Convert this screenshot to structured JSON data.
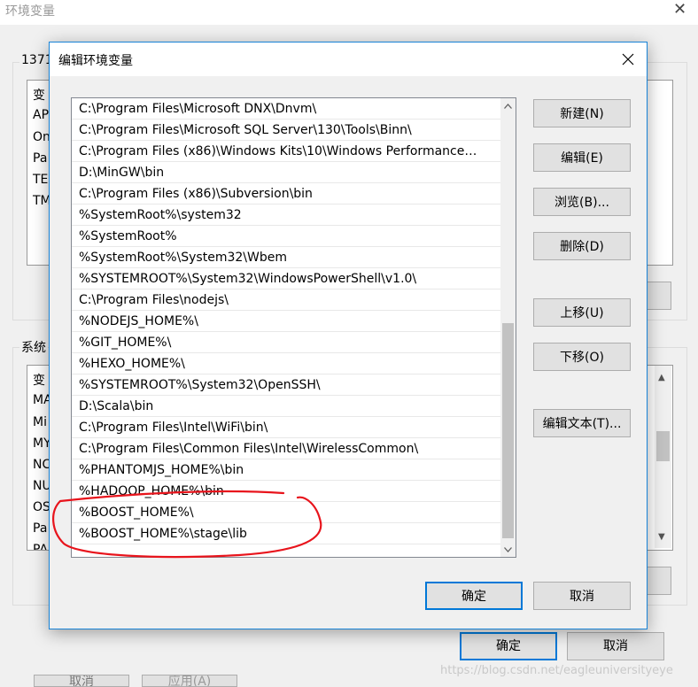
{
  "background": {
    "title": "环境变量",
    "user_group_label": "1371",
    "user_vars_col": "变",
    "user_vars": [
      "AP",
      "On",
      "Pa",
      "TE",
      "TM"
    ],
    "system_group_label": "系统",
    "system_vars_col": "变",
    "system_vars": [
      "MA",
      "Mi",
      "MY",
      "NC",
      "NU",
      "OS",
      "Pa",
      "PA"
    ],
    "ok_label": "确定",
    "cancel_label": "取消",
    "bottom_btn1": "取消",
    "bottom_btn2": "应用(A)",
    "watermark": "https://blog.csdn.net/eagleuniversityeye"
  },
  "dialog": {
    "title": "编辑环境变量",
    "paths": [
      "C:\\Program Files\\Microsoft DNX\\Dnvm\\",
      "C:\\Program Files\\Microsoft SQL Server\\130\\Tools\\Binn\\",
      "C:\\Program Files (x86)\\Windows Kits\\10\\Windows Performance…",
      "D:\\MinGW\\bin",
      "C:\\Program Files (x86)\\Subversion\\bin",
      "%SystemRoot%\\system32",
      "%SystemRoot%",
      "%SystemRoot%\\System32\\Wbem",
      "%SYSTEMROOT%\\System32\\WindowsPowerShell\\v1.0\\",
      "C:\\Program Files\\nodejs\\",
      "%NODEJS_HOME%\\",
      "%GIT_HOME%\\",
      "%HEXO_HOME%\\",
      "%SYSTEMROOT%\\System32\\OpenSSH\\",
      "D:\\Scala\\bin",
      "C:\\Program Files\\Intel\\WiFi\\bin\\",
      "C:\\Program Files\\Common Files\\Intel\\WirelessCommon\\",
      "%PHANTOMJS_HOME%\\bin",
      "%HADOOP_HOME%\\bin",
      "%BOOST_HOME%\\",
      "%BOOST_HOME%\\stage\\lib"
    ],
    "buttons": {
      "new": "新建(N)",
      "edit": "编辑(E)",
      "browse": "浏览(B)...",
      "delete": "删除(D)",
      "move_up": "上移(U)",
      "move_down": "下移(O)",
      "edit_text": "编辑文本(T)...",
      "ok": "确定",
      "cancel": "取消"
    }
  },
  "colors": {
    "accent": "#0078d7",
    "annotation": "#e8141c"
  }
}
